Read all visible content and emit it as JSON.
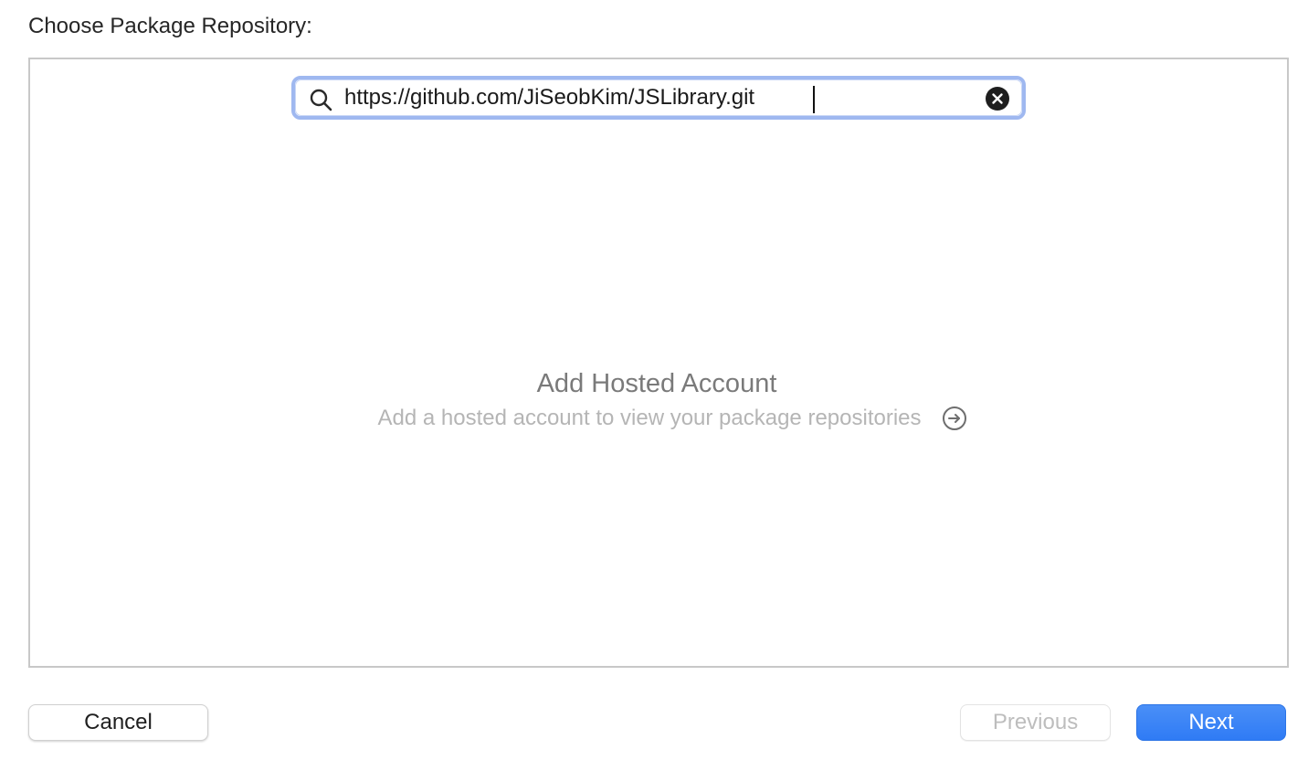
{
  "dialog": {
    "heading": "Choose Package Repository:"
  },
  "search": {
    "value": "https://github.com/JiSeobKim/JSLibrary.git",
    "search_icon": "magnifying-glass",
    "clear_icon": "xmark-circle-fill"
  },
  "empty_state": {
    "title": "Add Hosted Account",
    "subtitle": "Add a hosted account to view your package repositories",
    "action_icon": "arrow-right-circle"
  },
  "buttons": {
    "cancel": "Cancel",
    "previous": "Previous",
    "next": "Next"
  },
  "colors": {
    "accent": "#3381F6",
    "focus_ring": "#9FB8F0",
    "disabled_text": "#BDBDBD"
  }
}
